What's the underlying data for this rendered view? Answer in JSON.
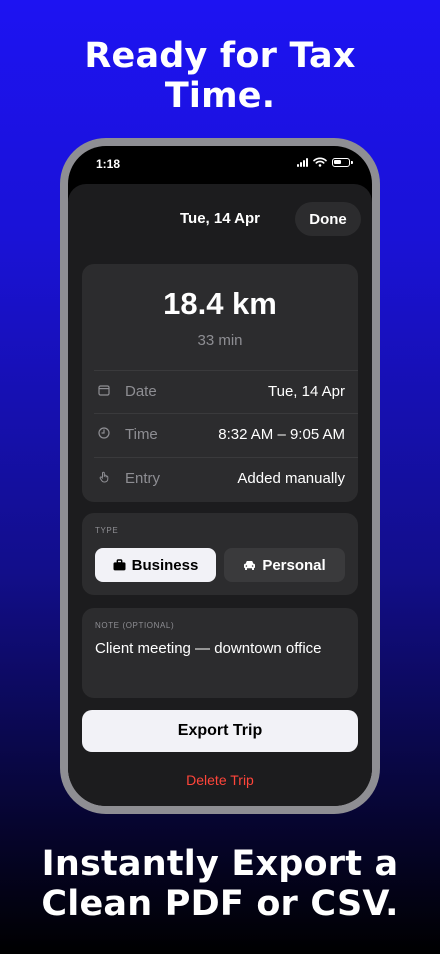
{
  "marketing": {
    "headline_top": [
      "Ready for Tax",
      "Time."
    ],
    "headline_bottom": [
      "Instantly Export a",
      "Clean PDF or CSV."
    ]
  },
  "status_bar": {
    "time": "1:18"
  },
  "nav": {
    "title": "Tue, 14 Apr",
    "done_label": "Done"
  },
  "trip": {
    "distance": "18.4 km",
    "duration": "33 min",
    "details": [
      {
        "icon": "calendar-icon",
        "label": "Date",
        "value": "Tue, 14 Apr"
      },
      {
        "icon": "clock-icon",
        "label": "Time",
        "value": "8:32 AM – 9:05 AM"
      },
      {
        "icon": "hand-tap-icon",
        "label": "Entry",
        "value": "Added manually"
      }
    ]
  },
  "type_section": {
    "label": "TYPE",
    "options": [
      {
        "icon": "briefcase-icon",
        "label": "Business",
        "selected": true
      },
      {
        "icon": "car-icon",
        "label": "Personal",
        "selected": false
      }
    ]
  },
  "note_section": {
    "label": "NOTE (OPTIONAL)",
    "value": "Client meeting — downtown office"
  },
  "actions": {
    "export_label": "Export Trip",
    "delete_label": "Delete Trip"
  },
  "colors": {
    "background_top": "#1d13f2",
    "background_bottom": "#000000",
    "card": "#2c2c2e",
    "sheet": "#1c1c1e",
    "destructive": "#ff453a"
  }
}
